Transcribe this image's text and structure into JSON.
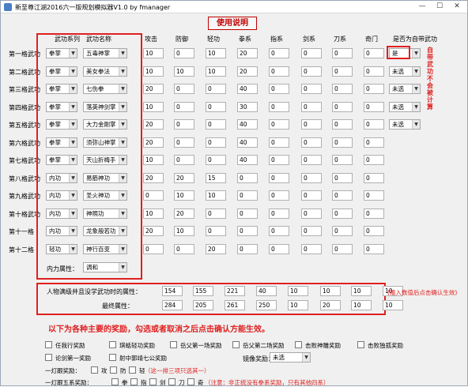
{
  "window": {
    "title": "新至尊江湖2016六一版规划模拟器V1.0 by fmanager",
    "minimize_glyph": "—",
    "maximize_glyph": "☐",
    "close_glyph": "✕"
  },
  "help_button": "使用说明",
  "headers": {
    "school": "武功系列",
    "skill": "武功名称",
    "stats": [
      "攻击",
      "防御",
      "轻功",
      "拳系",
      "指系",
      "剑系",
      "刀系",
      "奇门"
    ],
    "custom": "是否为自带武功"
  },
  "dropdown_arrow": "▼",
  "rows": [
    {
      "label": "第一格武功",
      "school": "拳掌",
      "skill": "五毒神掌",
      "stats": [
        "10",
        "0",
        "10",
        "20",
        "0",
        "0",
        "0",
        "0"
      ],
      "custom": "是"
    },
    {
      "label": "第二格武功",
      "school": "拳掌",
      "skill": "美女拳法",
      "stats": [
        "10",
        "10",
        "10",
        "20",
        "0",
        "0",
        "0",
        "0"
      ],
      "custom": "未选"
    },
    {
      "label": "第三格武功",
      "school": "拳掌",
      "skill": "七伤拳",
      "stats": [
        "20",
        "0",
        "0",
        "40",
        "0",
        "0",
        "0",
        "0"
      ],
      "custom": "未选"
    },
    {
      "label": "第四格武功",
      "school": "拳掌",
      "skill": "落英神剑掌",
      "stats": [
        "10",
        "0",
        "0",
        "30",
        "0",
        "0",
        "0",
        "0"
      ],
      "custom": "未选"
    },
    {
      "label": "第五格武功",
      "school": "拳掌",
      "skill": "大力金刚掌",
      "stats": [
        "20",
        "0",
        "0",
        "40",
        "0",
        "0",
        "0",
        "0"
      ],
      "custom": "未选"
    },
    {
      "label": "第六格武功",
      "school": "拳掌",
      "skill": "须弥山神掌",
      "stats": [
        "20",
        "0",
        "0",
        "40",
        "0",
        "0",
        "0",
        "0"
      ],
      "custom": ""
    },
    {
      "label": "第七格武功",
      "school": "拳掌",
      "skill": "天山折梅手",
      "stats": [
        "10",
        "0",
        "0",
        "40",
        "0",
        "0",
        "0",
        "0"
      ],
      "custom": ""
    },
    {
      "label": "第八格武功",
      "school": "内功",
      "skill": "易筋神功",
      "stats": [
        "20",
        "20",
        "15",
        "0",
        "0",
        "0",
        "0",
        "0"
      ],
      "custom": ""
    },
    {
      "label": "第九格武功",
      "school": "内功",
      "skill": "圣火神功",
      "stats": [
        "0",
        "10",
        "10",
        "0",
        "0",
        "0",
        "0",
        "0"
      ],
      "custom": ""
    },
    {
      "label": "第十格武功",
      "school": "内功",
      "skill": "神照功",
      "stats": [
        "10",
        "20",
        "0",
        "0",
        "0",
        "0",
        "0",
        "0"
      ],
      "custom": ""
    },
    {
      "label": "第十一格",
      "school": "内功",
      "skill": "龙象般若功",
      "stats": [
        "20",
        "10",
        "0",
        "0",
        "0",
        "0",
        "0",
        "0"
      ],
      "custom": ""
    },
    {
      "label": "第十二格",
      "school": "轻功",
      "skill": "神行百变",
      "stats": [
        "0",
        "0",
        "20",
        "0",
        "0",
        "0",
        "0",
        "0"
      ],
      "custom": ""
    }
  ],
  "inner_attribute": {
    "label": "内力属性：",
    "value": "调和"
  },
  "vertical_note": "自带武功不会被计算",
  "totals": {
    "base_label": "人物满级并且没学武功时的属性：",
    "base_values": [
      "154",
      "155",
      "221",
      "40",
      "10",
      "10",
      "10",
      "10"
    ],
    "final_label": "最终属性：",
    "final_values": [
      "284",
      "205",
      "261",
      "250",
      "10",
      "20",
      "10",
      "10"
    ],
    "note": "(输入数值后点击确认生效)"
  },
  "rewards": {
    "title": "以下为各种主要的奖励，勾选或者取消之后点击确认方能生效。",
    "row1": [
      "任我行奖励",
      "琪蛞轻功奖励",
      "岳父第一场奖励",
      "岳父第二场奖励",
      "击败神雕奖励",
      "击败独孤奖励"
    ],
    "row2": [
      "论剑第一奖励",
      "射中郭靖七公奖励"
    ],
    "mirror_label": "镜像奖励：",
    "mirror_value": "未选",
    "row3_label": "一灯跟奖励：",
    "row3_options": [
      "攻",
      "防",
      "轻"
    ],
    "row3_note": "（这一排三项只选其一）",
    "row4_label": "一灯跟五系奖励：",
    "row4_options": [
      "拳",
      "指",
      "剑",
      "刀",
      "奇"
    ],
    "row4_note": "（注意：非正统没有拳系奖励，只有其他四系）"
  }
}
